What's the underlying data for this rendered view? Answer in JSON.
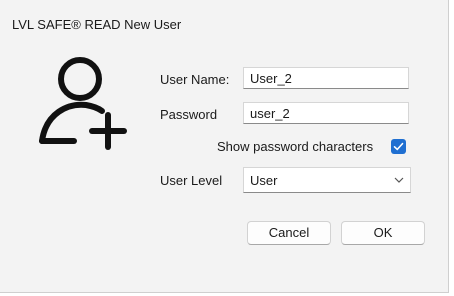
{
  "window": {
    "title": "LVL SAFE® READ New User",
    "accent_color": "#1f6fd1"
  },
  "icons": {
    "user": "add-user-icon",
    "chevron": "chevron-down-icon",
    "check": "checkmark-icon"
  },
  "form": {
    "username_label": "User Name:",
    "username_value": "User_2",
    "password_label": "Password",
    "password_value": "user_2",
    "show_password_label": "Show password characters",
    "show_password_checked": true,
    "user_level_label": "User Level",
    "user_level_value": "User"
  },
  "buttons": {
    "cancel": "Cancel",
    "ok": "OK"
  }
}
